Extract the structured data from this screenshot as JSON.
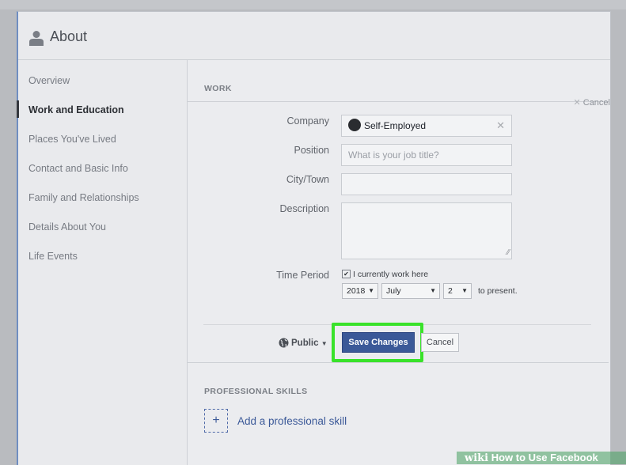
{
  "header": {
    "title": "About"
  },
  "sidebar": {
    "items": [
      {
        "label": "Overview"
      },
      {
        "label": "Work and Education"
      },
      {
        "label": "Places You've Lived"
      },
      {
        "label": "Contact and Basic Info"
      },
      {
        "label": "Family and Relationships"
      },
      {
        "label": "Details About You"
      },
      {
        "label": "Life Events"
      }
    ],
    "active_index": 1
  },
  "work": {
    "section_title": "WORK",
    "cancel_label": "Cancel",
    "company_label": "Company",
    "company_value": "Self-Employed",
    "position_label": "Position",
    "position_placeholder": "What is your job title?",
    "city_label": "City/Town",
    "description_label": "Description",
    "time_period_label": "Time Period",
    "currently_work_label": "I currently work here",
    "currently_work_checked": true,
    "year": "2018",
    "month": "July",
    "day": "2",
    "to_present": "to present.",
    "privacy_label": "Public",
    "save_label": "Save Changes",
    "cancel_button_label": "Cancel"
  },
  "skills": {
    "section_title": "PROFESSIONAL SKILLS",
    "plus_symbol": "+",
    "add_label": "Add a professional skill"
  },
  "watermark": {
    "prefix": "wiki",
    "text": "How to Use Facebook"
  },
  "colors": {
    "accent": "#3b5998",
    "highlight": "#39e22a"
  }
}
